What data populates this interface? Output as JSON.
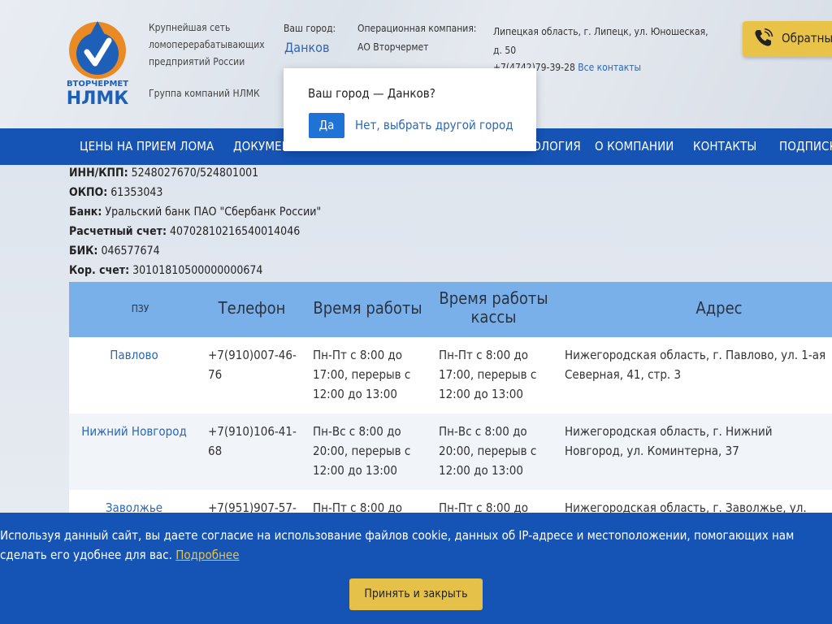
{
  "header": {
    "logo_text_top": "ВТОРЧЕРМЕТ",
    "logo_text_bottom": "НЛМК",
    "tagline": "Крупнейшая сеть ломоперерабатывающих предприятий России",
    "group": "Группа компаний НЛМК",
    "city_label": "Ваш город:",
    "city_value": "Данков",
    "operator_label": "Операционная компания:",
    "operator_value": "АО Вторчермет",
    "address": "Липецкая область, г. Липецк, ул. Юношеская, д. 50",
    "phone": "+7(4742)79-39-28",
    "all_contacts": "Все контакты",
    "callback_label": "Обратный звонок",
    "brand_blue": "#1553b5",
    "accent_yellow": "#e9c347"
  },
  "nav": {
    "items": [
      "ЦЕНЫ НА ПРИЕМ ЛОМА",
      "ДОКУМЕНТЫ",
      "ЭКОЛОГИЯ",
      "О КОМПАНИИ",
      "КОНТАКТЫ",
      "ПОДПИСКА"
    ]
  },
  "popup": {
    "question": "Ваш город — Данков?",
    "yes": "Да",
    "no": "Нет, выбрать другой город"
  },
  "requisites": [
    {
      "label": "ИНН/КПП:",
      "value": "5248027670/524801001"
    },
    {
      "label": "ОКПО:",
      "value": "61353043"
    },
    {
      "label": "Банк:",
      "value": "Уральский банк ПАО \"Сбербанк России\""
    },
    {
      "label": "Расчетный счет:",
      "value": "40702810216540014046"
    },
    {
      "label": "БИК:",
      "value": "046577674"
    },
    {
      "label": "Кор. счет:",
      "value": "30101810500000000674"
    }
  ],
  "table": {
    "headers": [
      "ПЗУ",
      "Телефон",
      "Время работы",
      "Время работы кассы",
      "Адрес"
    ],
    "rows": [
      {
        "name": "Павлово",
        "phone": "+7(910)007-46-76",
        "hours": "Пн-Пт с 8:00 до 17:00, перерыв с 12:00 до 13:00",
        "cash_hours": "Пн-Пт с 8:00 до 17:00, перерыв с 12:00 до 13:00",
        "address": "Нижегородская область, г. Павлово, ул. 1-ая Северная, 41, стр. 3"
      },
      {
        "name": "Нижний Новгород",
        "phone": "+7(910)106-41-68",
        "hours": "Пн-Вс с 8:00 до 20:00, перерыв с 12:00 до 13:00",
        "cash_hours": "Пн-Вс с 8:00 до 20:00, перерыв с 12:00 до 13:00",
        "address": "Нижегородская область, г. Нижний Новгород, ул. Коминтерна, 37"
      },
      {
        "name": "Заволжье",
        "phone": "+7(951)907-57-",
        "hours": "Пн-Пт с 8:00 до",
        "cash_hours": "Пн-Пт с 8:00 до",
        "address": "Нижегородская область, г. Заволжье, ул."
      }
    ]
  },
  "cookie": {
    "text": "Используя данный сайт, вы даете согласие на использование файлов cookie, данных об IP-адресе и местоположении, помогающих нам сделать его удобнее для вас.",
    "more": "Подробнее",
    "accept": "Принять и закрыть"
  }
}
